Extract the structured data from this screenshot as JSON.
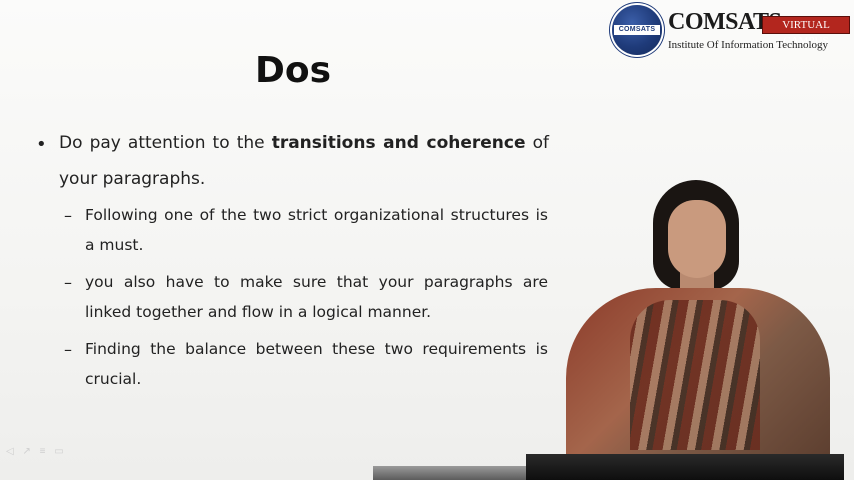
{
  "logo": {
    "seal_text": "COMSATS",
    "brand": "COMSATS",
    "badge": "VIRTUAL CAMPUS",
    "institute": "Institute Of Information Technology"
  },
  "slide": {
    "title": "Dos",
    "bullet": {
      "line1_pre": "Do pay attention to the ",
      "line1_bold": "transitions and coherence",
      "line1_post": " of",
      "line2": "your paragraphs."
    },
    "subpoints": [
      {
        "line1": "Following one of the two strict organizational structures is",
        "line2": "a must."
      },
      {
        "line1": " you also have to make sure that your paragraphs are",
        "line2": "linked together and flow in a logical manner."
      },
      {
        "line1": "Finding the balance between these two requirements is",
        "line2": "crucial."
      }
    ],
    "bullet_symbol": "•",
    "dash_symbol": "–"
  },
  "icons": {
    "presenter": "presenter-video",
    "slide_controls": "slide-nav-icons"
  }
}
